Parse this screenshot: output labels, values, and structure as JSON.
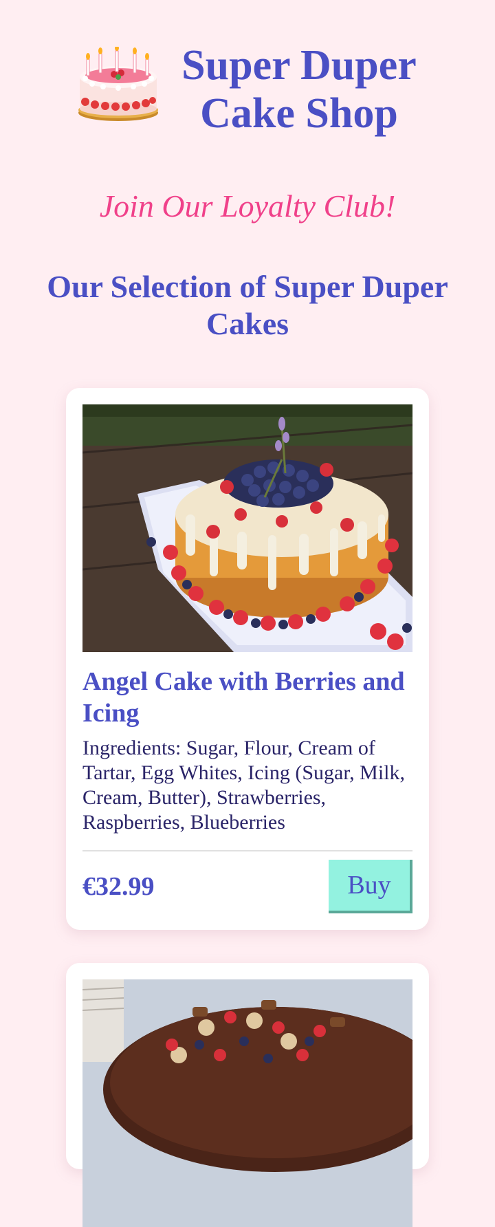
{
  "header": {
    "title": "Super Duper Cake Shop",
    "logo_icon": "birthday-cake-icon"
  },
  "loyalty": {
    "link_text": "Join Our Loyalty Club!"
  },
  "section": {
    "title": "Our Selection of Super Duper Cakes"
  },
  "products": [
    {
      "name": "Angel Cake with Berries and Icing",
      "ingredients": "Ingredients: Sugar, Flour, Cream of Tartar, Egg Whites, Icing (Sugar, Milk, Cream, Butter), Strawberries, Raspberries, Blueberries",
      "price": "€32.99",
      "buy_label": "Buy"
    }
  ],
  "colors": {
    "background": "#ffeef2",
    "brand": "#4a4fc4",
    "accent": "#f0418a",
    "button": "#93f2e0"
  }
}
